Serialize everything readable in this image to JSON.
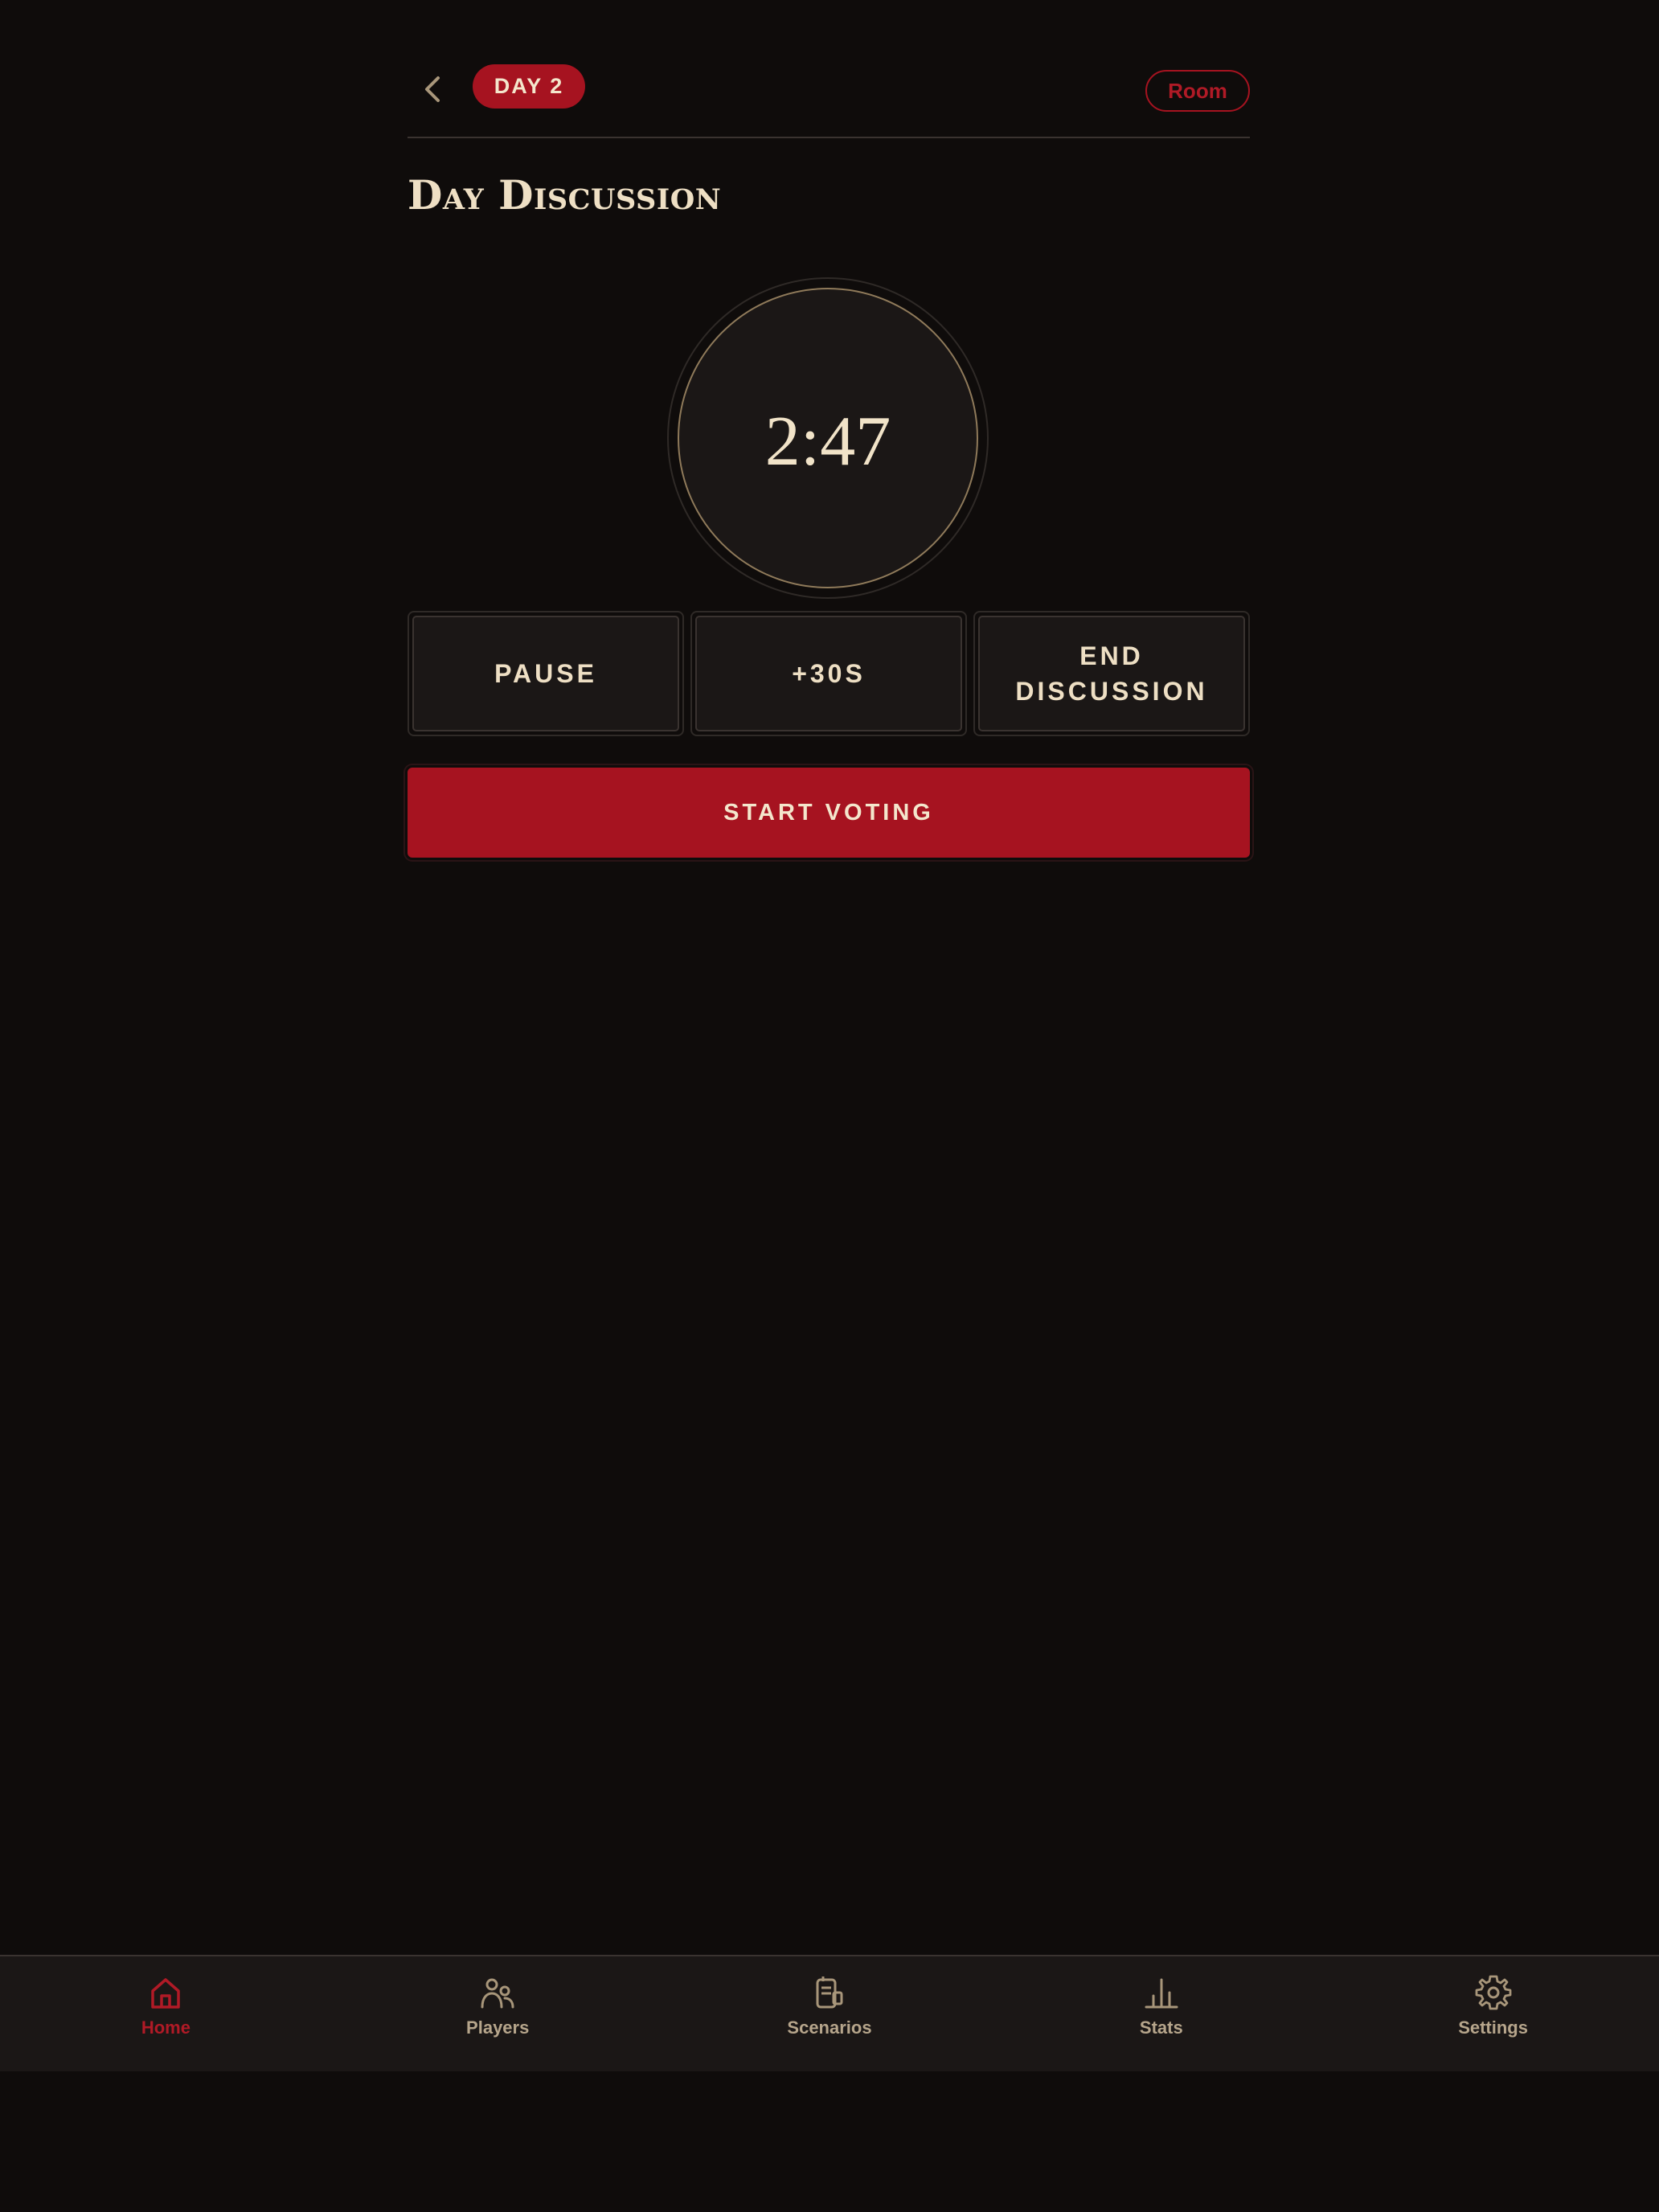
{
  "header": {
    "day_badge": "DAY 2",
    "room_label": "Room",
    "back_icon": "chevron-left-icon"
  },
  "main": {
    "title": "Day Discussion",
    "timer": "2:47",
    "actions": {
      "pause": "PAUSE",
      "add_time": "+30S",
      "end_discussion": "END DISCUSSION"
    },
    "start_voting": "START VOTING"
  },
  "nav": {
    "items": [
      {
        "label": "Home",
        "icon": "home-icon",
        "active": true
      },
      {
        "label": "Players",
        "icon": "players-icon",
        "active": false
      },
      {
        "label": "Scenarios",
        "icon": "scenarios-icon",
        "active": false
      },
      {
        "label": "Stats",
        "icon": "stats-icon",
        "active": false
      },
      {
        "label": "Settings",
        "icon": "gear-icon",
        "active": false
      }
    ]
  },
  "colors": {
    "background": "#0f0c0b",
    "surface": "#1b1716",
    "accent": "#a61320",
    "text": "#eedfc4",
    "muted": "#b6a58b",
    "timer_ring": "#8f7a5a"
  }
}
